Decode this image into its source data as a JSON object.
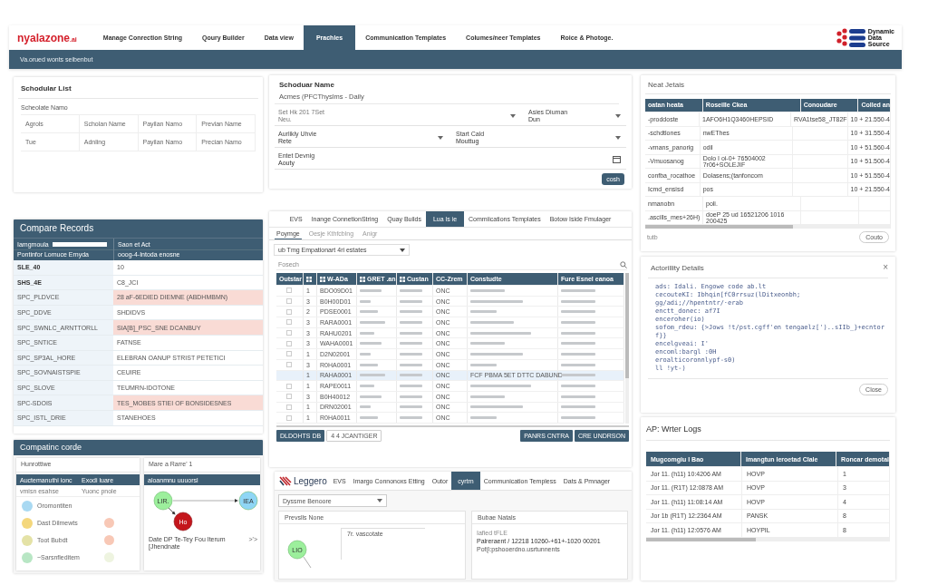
{
  "header": {
    "logo": {
      "main": "nyalazone",
      "suffix": ".ai"
    },
    "nav": [
      {
        "label": "Manage Conrection String",
        "selected": false
      },
      {
        "label": "Qoury Builder",
        "selected": false
      },
      {
        "label": "Data view",
        "selected": false
      },
      {
        "label": "Prachles",
        "selected": true
      },
      {
        "label": "Communication Templates",
        "selected": false
      },
      {
        "label": "Columes/neer Templates",
        "selected": false
      },
      {
        "label": "Roice & Photoge.",
        "selected": false
      }
    ],
    "brand": [
      "Dynamic",
      "Data",
      "Source"
    ],
    "subtitle": "Va.orued wonts seibenbut"
  },
  "schedular_list": {
    "title": "Schodular List",
    "section": "Scheolate Namo",
    "columns": [
      "Agrols",
      "Scholan Name",
      "Payilan Namo",
      "Previan Name"
    ],
    "rows": [
      [
        "Tue",
        "Adnling",
        "Payilan Namo",
        "Precian Namo"
      ]
    ]
  },
  "compare_records": {
    "title": "Compare Records",
    "filter_label": "Iamgmoula",
    "left_header": "Pontinfor Lomuce Ernyda",
    "right_header": "Saon et Act",
    "right_subheader": "ooog-4-Intoda enosne",
    "rows": [
      {
        "key": "SLE_40",
        "value": "10",
        "bold": true,
        "highlight": false
      },
      {
        "key": "SHS_4E",
        "value": "C8_JCI",
        "bold": true,
        "highlight": false
      },
      {
        "key": "SPC_PLDVCE",
        "value": "28 aF-6EDIED DIEMNE (ABDHMBMN)",
        "bold": false,
        "highlight": true
      },
      {
        "key": "SPC_DDVE",
        "value": "SHDIDVS",
        "bold": false,
        "highlight": false
      },
      {
        "key": "SPC_SWNLC_ARNTTORLL",
        "value": "SIA[B]_PSC_SNE DCANBUY",
        "bold": false,
        "highlight": true
      },
      {
        "key": "SPC_SNTICE",
        "value": "FATNSE",
        "bold": false,
        "highlight": false
      },
      {
        "key": "SPC_SP3AL_HORE",
        "value": "ELEBRAN OANUP STRIST PETETICI",
        "bold": false,
        "highlight": false
      },
      {
        "key": "SPC_SOVNAISTSPIE",
        "value": "CEUIRE",
        "bold": false,
        "highlight": false
      },
      {
        "key": "SPC_SLOVE",
        "value": "TEUMRN-IDOTONE",
        "bold": false,
        "highlight": false
      },
      {
        "key": "SPC-SDOIS",
        "value": "TES_MOBES STIEI OF BONSIDESNES",
        "bold": false,
        "highlight": true
      },
      {
        "key": "SPC_ISTL_DRIE",
        "value": "STANEHOES",
        "bold": false,
        "highlight": false
      }
    ]
  },
  "compatinc": {
    "title": "Compatinc corde",
    "search": "Hunrottiwe",
    "columns": [
      "Auctemanuthi ionc",
      "Exodi luare"
    ],
    "subheaders": [
      "vmisn esahse",
      "Yuonc pnole"
    ],
    "legend": [
      {
        "label": "Oromontiten",
        "color": "#a9d9f2"
      },
      {
        "label": "Dast Dilmewts",
        "color": "#f4d77c",
        "swatch": {
          "color": "#f8c8b6"
        }
      },
      {
        "label": "Toot Bubdt",
        "color": "#e4e2a6",
        "swatch": {
          "color": "#f8c8b6"
        }
      },
      {
        "label": "~Sarsnfleditem",
        "color": "#b8e6c4",
        "swatch": {
          "color": "#eef4e0"
        }
      }
    ],
    "graph_title": "Mare a Rarre' 1",
    "graph_header": "aloanmnu uuuorsl",
    "nodes": [
      {
        "label": "LIR.",
        "color": "#9cef9c"
      },
      {
        "label": "Ho",
        "color": "#c4161c"
      },
      {
        "label": "IEA",
        "color": "#8fd6f5"
      }
    ],
    "caption": "Date DP Te-Tey Fou Iterum [Jhendnate",
    "caption_2": ">'>"
  },
  "schedule_form": {
    "title": "Schoduar Name",
    "name": "Acmes (PFCThyslms - Daily",
    "fields": [
      {
        "label": "Set Hk 201 7Set",
        "value": "Neu."
      },
      {
        "label": "Asies Diuman",
        "value": "Dun"
      },
      {
        "label": "Aurlikly Uhvie",
        "value": "Rete"
      },
      {
        "label": "Start Cald",
        "value": "Mouttug"
      },
      {
        "label": "Entet Devnig",
        "value": "Aouty"
      }
    ],
    "button": "cosh"
  },
  "records": {
    "tabs": [
      {
        "label": "EVS",
        "selected": false
      },
      {
        "label": "Inange ConnetionString",
        "selected": false
      },
      {
        "label": "Quay Builds",
        "selected": false
      },
      {
        "label": "Lua ls ie",
        "selected": true
      },
      {
        "label": "Commiications Templates",
        "selected": false
      },
      {
        "label": "Botow Iside Fmulager",
        "selected": false
      }
    ],
    "subtabs": [
      {
        "label": "Poymge",
        "selected": true
      },
      {
        "label": "Oesje Kthfcblng",
        "selected": false
      },
      {
        "label": "Anigr",
        "selected": false
      }
    ],
    "dropdown": "ub Tmg Empationart 4ri estates",
    "search_placeholder": "Fosech",
    "columns": [
      {
        "kind": "text",
        "label": "Outstar"
      },
      {
        "kind": "icon"
      },
      {
        "kind": "icon_text",
        "label": "W-ADa"
      },
      {
        "kind": "icon_text",
        "label": "GRET .an"
      },
      {
        "kind": "icon_text",
        "label": "Custan"
      },
      {
        "kind": "text",
        "label": "CC-Zrem"
      },
      {
        "kind": "text",
        "label": "Constudte"
      },
      {
        "kind": "text",
        "label": "Fure Esnel eanoa"
      }
    ],
    "rows": [
      {
        "num": "1",
        "id": "BDO09D01",
        "code": "ONC",
        "selected": false
      },
      {
        "num": "3",
        "id": "B0H00D01",
        "code": "ONC",
        "selected": false
      },
      {
        "num": "2",
        "id": "PDSE0001",
        "code": "ONC",
        "selected": false
      },
      {
        "num": "3",
        "id": "RARA0001",
        "code": "ONC",
        "selected": false
      },
      {
        "num": "3",
        "id": "RAHU0201",
        "code": "ONC",
        "selected": false
      },
      {
        "num": "3",
        "id": "WAHA0001",
        "code": "ONC",
        "selected": false
      },
      {
        "num": "1",
        "id": "D2N02001",
        "code": "ONC",
        "selected": false
      },
      {
        "num": "3",
        "id": "R0HA0001",
        "code": "ONC",
        "selected": false
      },
      {
        "num": "1",
        "id": "RAHA0001",
        "code": "ONC",
        "selected": true,
        "note": "FCF PBMA 5ET DTTC DABUND"
      },
      {
        "num": "1",
        "id": "RAPE0011",
        "code": "ONC",
        "selected": false
      },
      {
        "num": "3",
        "id": "B0H40012",
        "code": "ONC",
        "selected": false
      },
      {
        "num": "1",
        "id": "DRN02001",
        "code": "ONC",
        "selected": false
      },
      {
        "num": "1",
        "id": "R0HA0011",
        "code": "ONC",
        "selected": false
      }
    ],
    "buttons_left": [
      "DLDOHTS DB",
      "4 4 JCANTIGER"
    ],
    "buttons_right": [
      "PANRS CNTRA",
      "CRE UNDRSON"
    ]
  },
  "nest_details": {
    "title": "Neat Jetais",
    "columns": [
      "oatan heata",
      "Roseille Ckea",
      "Conoudare",
      "Colled an"
    ],
    "rows": [
      [
        "-proddoste",
        "1AFO6H1Q3460HEPSID",
        "RVA1tse58_JT82F",
        "10 + 21.550-4"
      ],
      [
        "-schdtlones",
        "nwEThes",
        "",
        "10 + 31.550-4"
      ],
      [
        "-vmans_panorig",
        "odil",
        "",
        "10 + 51.560-4"
      ],
      [
        "-Vmuosanog",
        "Dolo I oi-0+ 76504002 7r06+SOLEJIF",
        "",
        "10 + 51.500-4"
      ],
      [
        "confba_rocathoe",
        "Dolasens;(tanfoncom",
        "",
        "10 + 51.550-4"
      ],
      [
        "Icmd_ensisd",
        "pos",
        "",
        "10 + 21.550-4"
      ],
      [
        "nmanobn",
        "poli.",
        "",
        ""
      ],
      [
        ".ascills_mes+26H)",
        "doeP 25 ud 16521206 1016 200425",
        "",
        ""
      ]
    ],
    "footer": "tutb",
    "button": "Couto"
  },
  "activity": {
    "title": "Actorillity Details",
    "close": "×",
    "lines": [
      "ads: Idali. Engowe code ab.lt",
      "cecouteKI: Ibhqin[fC0rrsuz(lDitxeonbh;",
      "gg/adi;//hpentntr/·erab",
      "enctt_donec: af7I",
      "enceroher(io)",
      "sofom_rdeu: {>Jows !t/pst.cgff'en tengaelz[')..sIIb_}+ecntorf}}",
      "encelgveai: I'",
      "encoml:bargl :0H",
      "eroalticoronnlypf-s0)",
      "ll !yt-)"
    ],
    "button": "Close"
  },
  "logs": {
    "title": "AP: Wrter Logs",
    "columns": [
      "Mugcomgiu I Bao",
      "Imangtun Ieroetad CIale",
      "Roncar demotal"
    ],
    "rows": [
      [
        "Jor 11. (h11) 10:4206 AM",
        "HOVP",
        "1"
      ],
      [
        "Jor 11. (R1T) 12:0878 AM",
        "HOVP",
        "3"
      ],
      [
        "Jor 11. (h11) 11:08:14 AM",
        "HOVP",
        "4"
      ],
      [
        "Jor 1b (R1T) 12:2364 AM",
        "PANSK",
        "8"
      ],
      [
        "Jor 11. (h11) 12:0576 AM",
        "HOYPIL",
        "8"
      ]
    ]
  },
  "leggero": {
    "logo": "Leggero",
    "tabs": [
      {
        "label": "EVS",
        "selected": false
      },
      {
        "label": "Imargo Connonoxs Etting",
        "selected": false
      },
      {
        "label": "Outor",
        "selected": false
      },
      {
        "label": "cyrtrn",
        "selected": true
      },
      {
        "label": "Communication Templess",
        "selected": false
      },
      {
        "label": "Dats & Pmnager",
        "selected": false
      }
    ],
    "dropdown": "Dyssme Benoore",
    "left_title": "Prevslls None",
    "node": "LIO",
    "tag": "7r. vascotate",
    "right_title": "Bubae Natals",
    "detail_label": "Iafied tFLE",
    "detail_value": "Palreraent / 12218 10260-+61+-1020 00201",
    "detail_link": "Pof(i:pshooerdno.usrtunnents"
  }
}
